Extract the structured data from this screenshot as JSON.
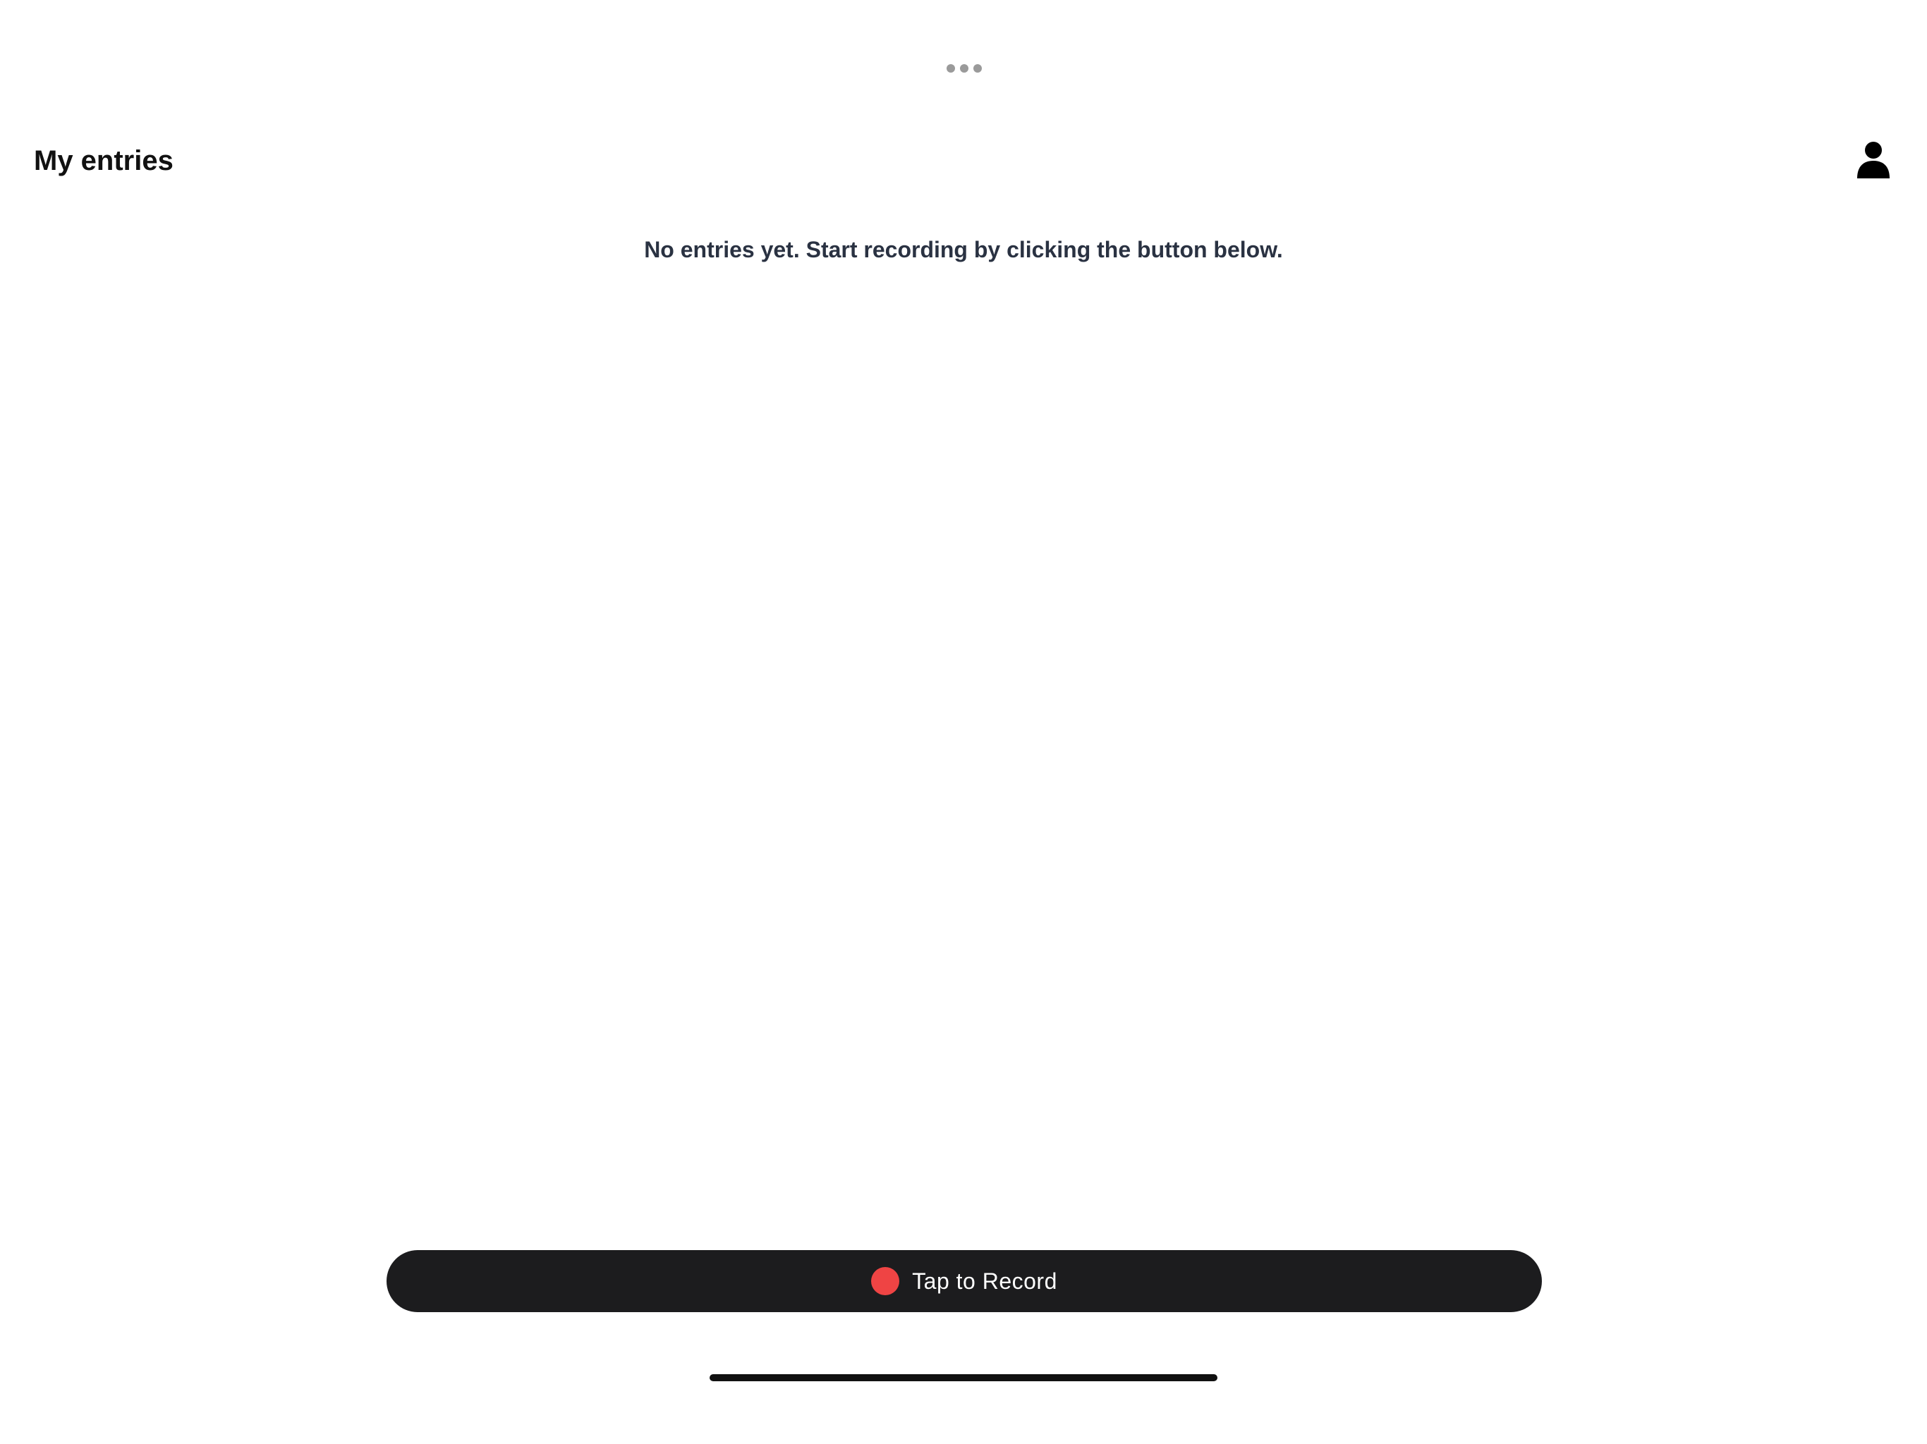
{
  "header": {
    "title": "My entries",
    "profile_icon": "person-icon"
  },
  "multitask": {
    "icon": "ellipsis-icon"
  },
  "main": {
    "empty_message": "No entries yet. Start recording by clicking the button below."
  },
  "record_button": {
    "label": "Tap to Record",
    "dot_color": "#ef4444",
    "background": "#1c1c1e"
  },
  "colors": {
    "background": "#ffffff",
    "text_primary": "#111111",
    "text_message": "#2a3242"
  }
}
